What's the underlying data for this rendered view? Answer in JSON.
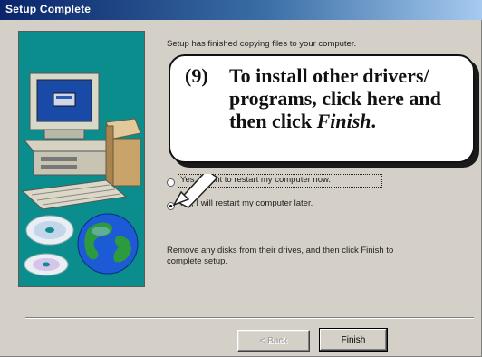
{
  "window": {
    "title": "Setup Complete",
    "titlebar_colors": [
      "#0a246a",
      "#a6caf0"
    ]
  },
  "content": {
    "intro": "Setup has finished copying files to your computer.",
    "radio_restart_now": "Yes, I want to restart my computer now.",
    "radio_restart_later": "No, I will restart my computer later.",
    "instructions_line1": "Remove any disks from their drives, and then click Finish to",
    "instructions_line2": "complete setup."
  },
  "buttons": {
    "back": "< Back",
    "finish": "Finish"
  },
  "callout": {
    "number": "(9)",
    "line1": "To install other drivers/",
    "line2": "programs, click here and",
    "line3_prefix": "then click ",
    "line3_emph": "Finish",
    "line3_suffix": "."
  },
  "art": {
    "background": "#0c8d8d",
    "icons": [
      "computer-icon",
      "cd-disc-icon",
      "globe-icon"
    ]
  },
  "selected_option": "restart-later"
}
